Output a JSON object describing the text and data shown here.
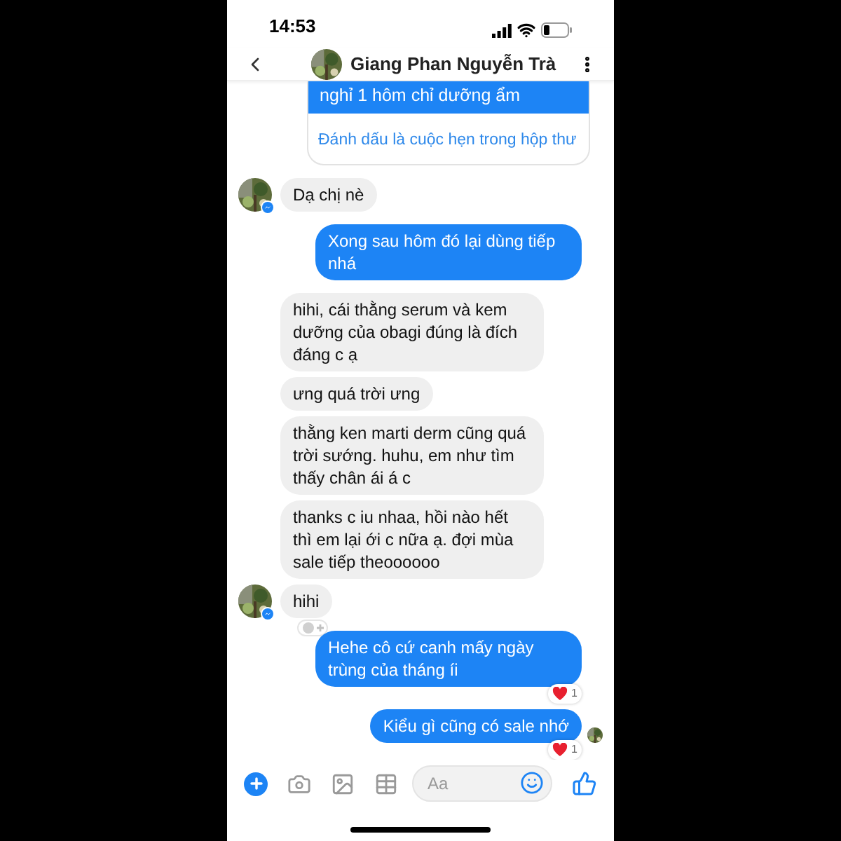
{
  "status_bar": {
    "time": "14:53"
  },
  "header": {
    "title": "Giang Phan Nguyễn Trà"
  },
  "messages": [
    {
      "kind": "event_card",
      "text": "nghỉ 1 hôm chỉ dưỡng ẩm",
      "action": "Đánh dấu là cuộc hẹn trong hộp thư"
    },
    {
      "kind": "incoming",
      "text": "Dạ chị nè",
      "avatar": true
    },
    {
      "kind": "outgoing",
      "text": "Xong sau hôm đó lại dùng tiếp nhá"
    },
    {
      "kind": "incoming",
      "text": "hihi, cái thằng serum và kem dưỡng của obagi đúng là đích đáng c ạ",
      "avatar": false
    },
    {
      "kind": "incoming",
      "text": "ưng quá trời ưng",
      "avatar": false
    },
    {
      "kind": "incoming",
      "text": "thằng ken marti derm cũng quá trời sướng. huhu, em như tìm thấy chân ái á c",
      "avatar": false
    },
    {
      "kind": "incoming",
      "text": "thanks c iu nhaa, hồi nào hết thì em lại ới c nữa ạ. đợi mùa sale tiếp theoooooo",
      "avatar": false
    },
    {
      "kind": "incoming",
      "text": "hihi",
      "avatar": true,
      "reaction_prompt": true
    },
    {
      "kind": "outgoing",
      "text": "Hehe cô cứ canh mấy ngày trùng của tháng íi",
      "reaction_count": "1"
    },
    {
      "kind": "outgoing",
      "text": "Kiểu gì cũng có sale nhớ",
      "reaction_count": "1",
      "seen": true
    }
  ],
  "composer": {
    "placeholder": "Aa"
  }
}
